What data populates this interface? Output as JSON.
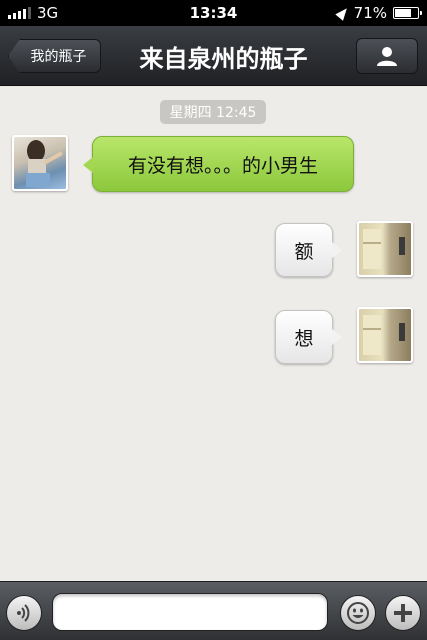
{
  "status_bar": {
    "carrier": "3G",
    "time": "13:34",
    "battery_label": "71%",
    "battery_level": 0.71
  },
  "nav": {
    "back_label": "我的瓶子",
    "title": "来自泉州的瓶子",
    "profile_icon": "person-icon"
  },
  "chat": {
    "timestamp": "星期四 12:45",
    "messages": [
      {
        "direction": "received",
        "text": "有没有想。。。的小男生"
      },
      {
        "direction": "sent",
        "text": "额"
      },
      {
        "direction": "sent",
        "text": "想"
      }
    ]
  },
  "input_bar": {
    "voice_icon": "voice-icon",
    "message_value": "",
    "emoji_icon": "emoji-icon",
    "plus_icon": "plus-icon"
  },
  "colors": {
    "received_bubble": "#a3d752",
    "sent_bubble": "#f2f2f2",
    "nav_background": "#2a2c30"
  }
}
